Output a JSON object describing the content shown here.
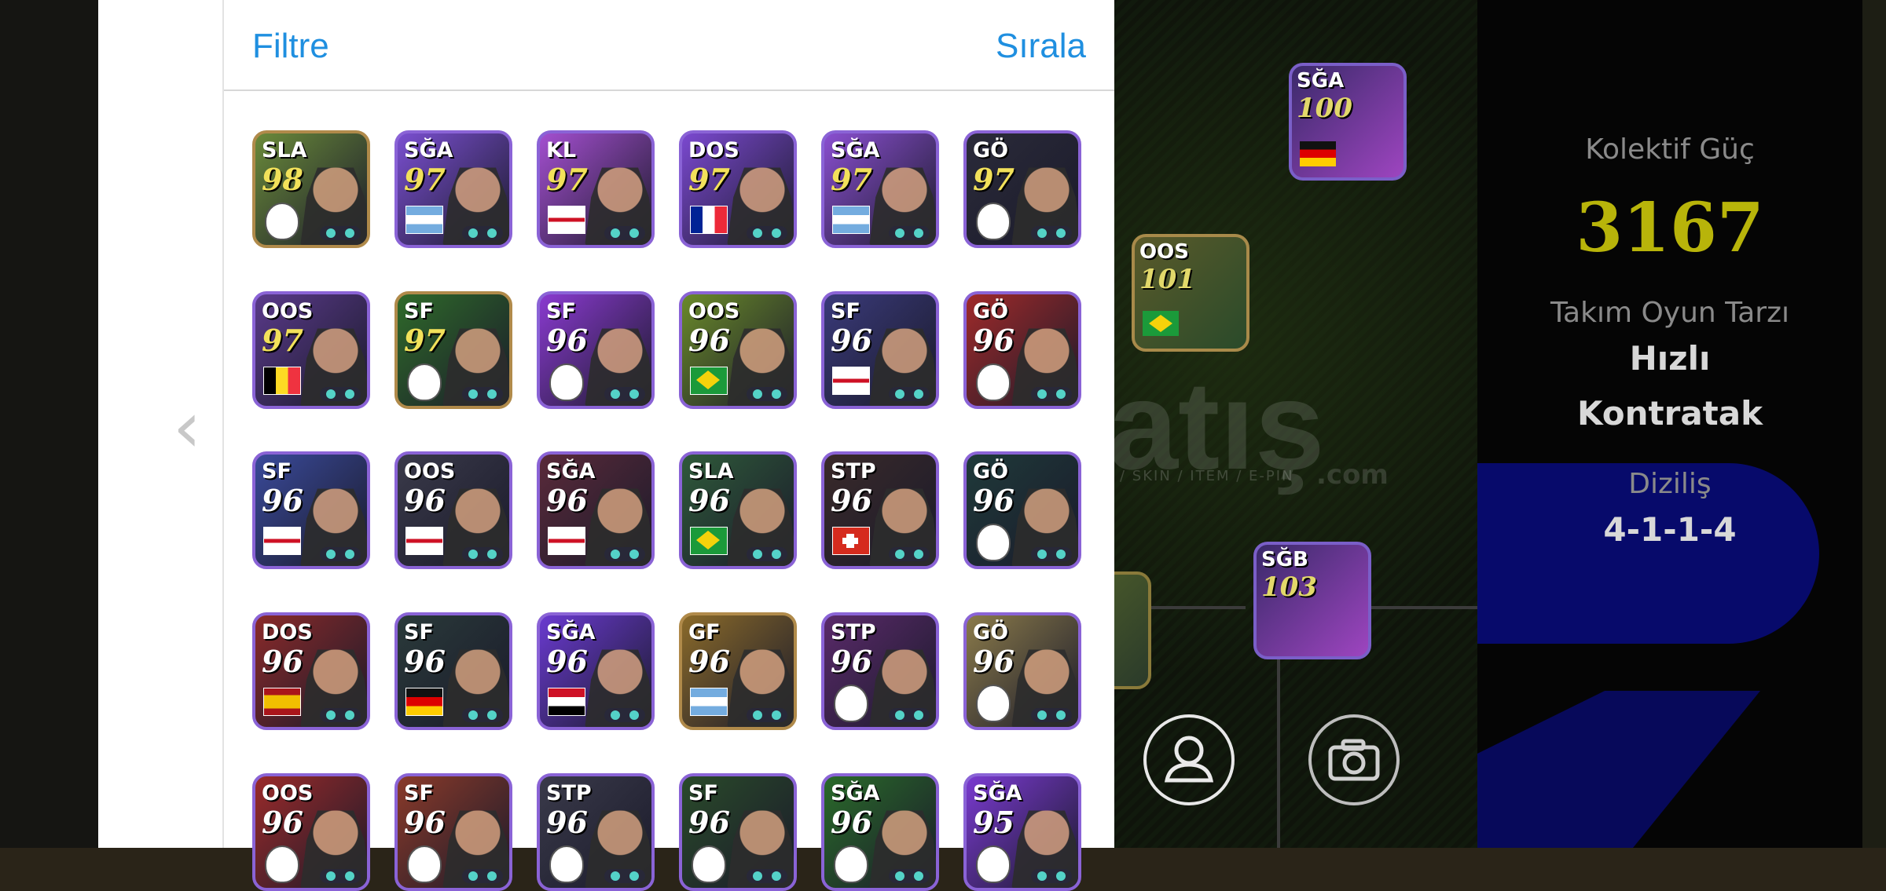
{
  "header": {
    "filter_label": "Filtre",
    "sort_label": "Sırala"
  },
  "watermark": {
    "main": "atış",
    "sub": "/ SKIN / ITEM / E-PIN",
    "suffix": ".com"
  },
  "team": {
    "collective_label": "Kolektif Güç",
    "collective_value": "3167",
    "style_label": "Takım Oyun Tarzı",
    "style_value_line1": "Hızlı",
    "style_value_line2": "Kontratak",
    "formation_label": "Diziliş",
    "formation_value": "4-1-1-4"
  },
  "pitch_players": [
    {
      "pos": "SĞA",
      "rating": "100",
      "flag": "germany"
    },
    {
      "pos": "OOS",
      "rating": "101",
      "flag": "brazil"
    },
    {
      "pos": "SĞB",
      "rating": "103",
      "flag": "club"
    }
  ],
  "cards": [
    {
      "pos": "SLA",
      "rating": "98",
      "flag": "club",
      "color": "#6a8a3a"
    },
    {
      "pos": "SĞA",
      "rating": "97",
      "flag": "argentina",
      "color": "#7a4fd0"
    },
    {
      "pos": "KL",
      "rating": "97",
      "flag": "england",
      "color": "#a44fd0"
    },
    {
      "pos": "DOS",
      "rating": "97",
      "flag": "france",
      "color": "#7b49d0"
    },
    {
      "pos": "SĞA",
      "rating": "97",
      "flag": "argentina",
      "color": "#8a4fd0"
    },
    {
      "pos": "GÖ",
      "rating": "97",
      "flag": "club",
      "color": "#2b2b3a"
    },
    {
      "pos": "OOS",
      "rating": "97",
      "flag": "belgium",
      "color": "#5a3a8a"
    },
    {
      "pos": "SF",
      "rating": "97",
      "flag": "club",
      "color": "#2f6a2a"
    },
    {
      "pos": "SF",
      "rating": "96",
      "flag": "club",
      "color": "#8a3ad0"
    },
    {
      "pos": "OOS",
      "rating": "96",
      "flag": "brazil",
      "color": "#6a8a2a"
    },
    {
      "pos": "SF",
      "rating": "96",
      "flag": "england",
      "color": "#3a3a7a"
    },
    {
      "pos": "GÖ",
      "rating": "96",
      "flag": "club",
      "color": "#a02a2a"
    },
    {
      "pos": "SF",
      "rating": "96",
      "flag": "england",
      "color": "#3a4a9a"
    },
    {
      "pos": "OOS",
      "rating": "96",
      "flag": "england",
      "color": "#3a3a4a"
    },
    {
      "pos": "SĞA",
      "rating": "96",
      "flag": "england",
      "color": "#5a2a3a"
    },
    {
      "pos": "SLA",
      "rating": "96",
      "flag": "brazil",
      "color": "#2f5a3a"
    },
    {
      "pos": "STP",
      "rating": "96",
      "flag": "switzerland",
      "color": "#3a2a2a"
    },
    {
      "pos": "GÖ",
      "rating": "96",
      "flag": "club",
      "color": "#1f3a3a"
    },
    {
      "pos": "DOS",
      "rating": "96",
      "flag": "spain",
      "color": "#8a2a2a"
    },
    {
      "pos": "SF",
      "rating": "96",
      "flag": "germany",
      "color": "#2a3a3a"
    },
    {
      "pos": "SĞA",
      "rating": "96",
      "flag": "egypt",
      "color": "#6a3ad0"
    },
    {
      "pos": "GF",
      "rating": "96",
      "flag": "argentina",
      "color": "#8a6a2a"
    },
    {
      "pos": "STP",
      "rating": "96",
      "flag": "club",
      "color": "#5a2a6a"
    },
    {
      "pos": "GÖ",
      "rating": "96",
      "flag": "club",
      "color": "#8a7a4a"
    },
    {
      "pos": "OOS",
      "rating": "96",
      "flag": "club",
      "color": "#9a2a2a"
    },
    {
      "pos": "SF",
      "rating": "96",
      "flag": "club",
      "color": "#8a3a2a"
    },
    {
      "pos": "STP",
      "rating": "96",
      "flag": "club",
      "color": "#3a3a4a"
    },
    {
      "pos": "SF",
      "rating": "96",
      "flag": "club",
      "color": "#2a4a2a"
    },
    {
      "pos": "SĞA",
      "rating": "96",
      "flag": "club",
      "color": "#2a6a2a"
    },
    {
      "pos": "SĞA",
      "rating": "95",
      "flag": "club",
      "color": "#7a3ad0"
    }
  ],
  "colors": {
    "accent_blue": "#1f8fe0",
    "rating_yellow": "#f2e15a",
    "rating_white": "#ffffff",
    "collective_gold": "#b8b40a"
  }
}
